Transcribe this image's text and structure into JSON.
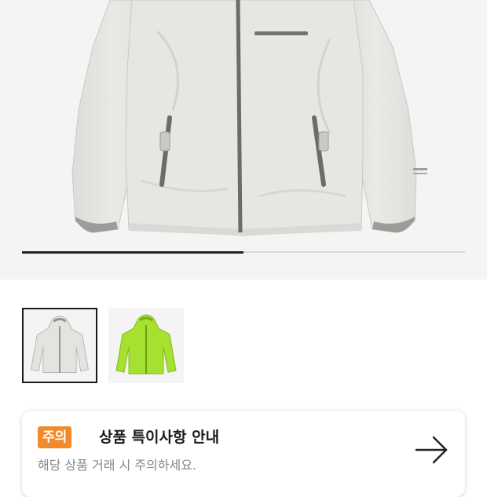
{
  "gallery": {
    "main_image_icon": "jacket-light-gray",
    "progress_fraction": 0.5,
    "thumbnails": [
      {
        "icon": "jacket-light-gray",
        "color": "#e3e4e0",
        "selected": true
      },
      {
        "icon": "jacket-lime-green",
        "color": "#a6e030",
        "selected": false
      }
    ]
  },
  "notice": {
    "badge": "주의",
    "badge_color": "#f08a2a",
    "title": "상품 특이사항 안내",
    "subtitle": "해당 상품 거래 시 주의하세요.",
    "action_icon": "arrow-right-icon"
  }
}
